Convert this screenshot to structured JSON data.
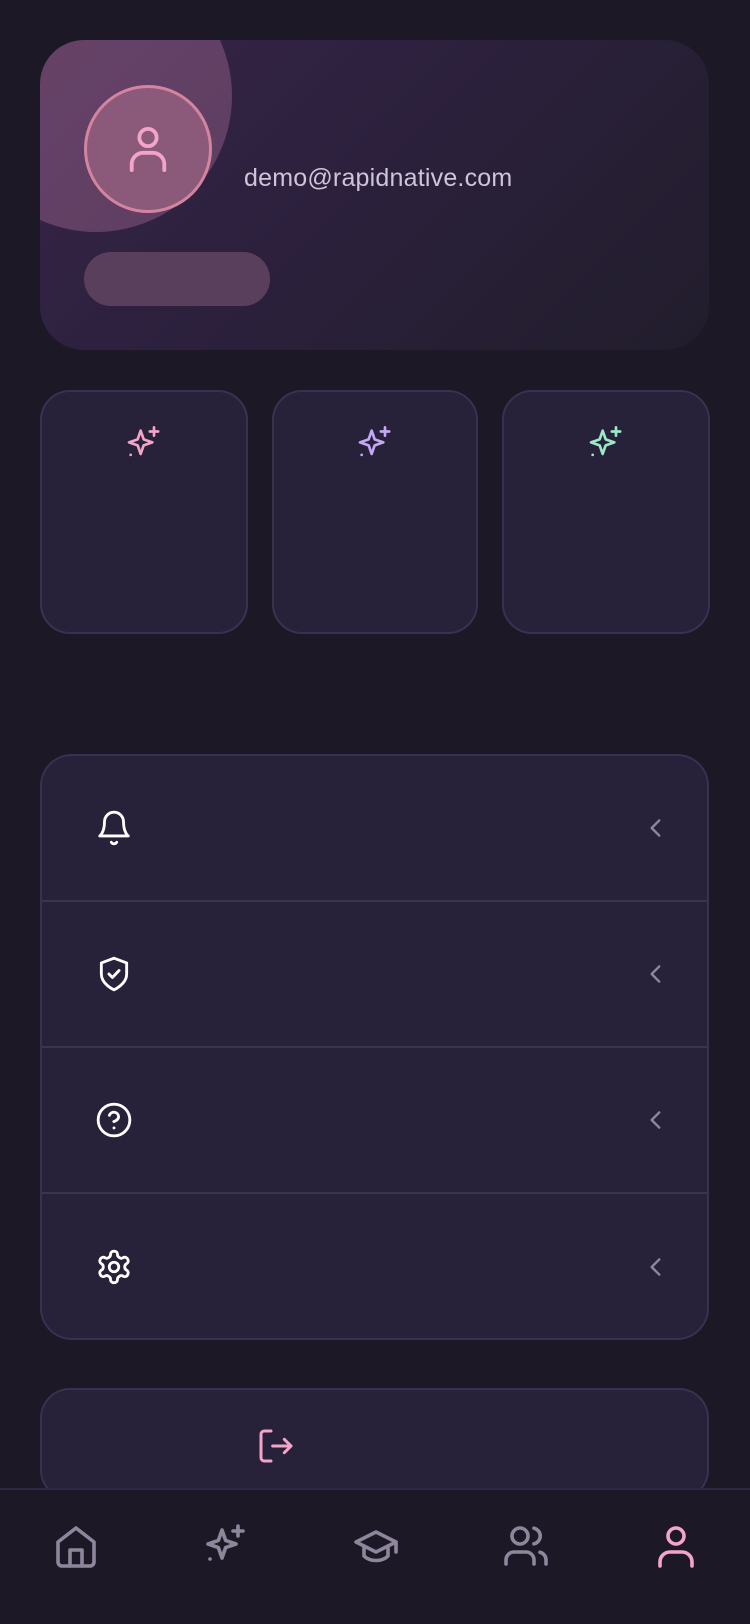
{
  "profile": {
    "email": "demo@rapidnative.com",
    "avatar_icon": "user-icon"
  },
  "stats": [
    {
      "icon": "sparkles-icon",
      "color": "#f2a5c8"
    },
    {
      "icon": "sparkles-icon",
      "color": "#c5a8f5"
    },
    {
      "icon": "sparkles-icon",
      "color": "#9be8c7"
    }
  ],
  "menu": {
    "items": [
      {
        "icon": "bell-icon"
      },
      {
        "icon": "shield-check-icon"
      },
      {
        "icon": "help-circle-icon"
      },
      {
        "icon": "settings-icon"
      }
    ],
    "chevron_icon": "chevron-left-icon"
  },
  "logout": {
    "icon": "log-out-icon",
    "color": "#f2a5c8"
  },
  "tabbar": {
    "tabs": [
      {
        "icon": "home-icon",
        "active": false
      },
      {
        "icon": "sparkles-icon",
        "active": false
      },
      {
        "icon": "graduation-cap-icon",
        "active": false
      },
      {
        "icon": "users-icon",
        "active": false
      },
      {
        "icon": "user-icon",
        "active": true
      }
    ],
    "active_color": "#f2a5c8",
    "inactive_color": "#8e879c"
  },
  "colors": {
    "background": "#1c1826",
    "card": "#272139",
    "accent": "#f2a5c8"
  }
}
